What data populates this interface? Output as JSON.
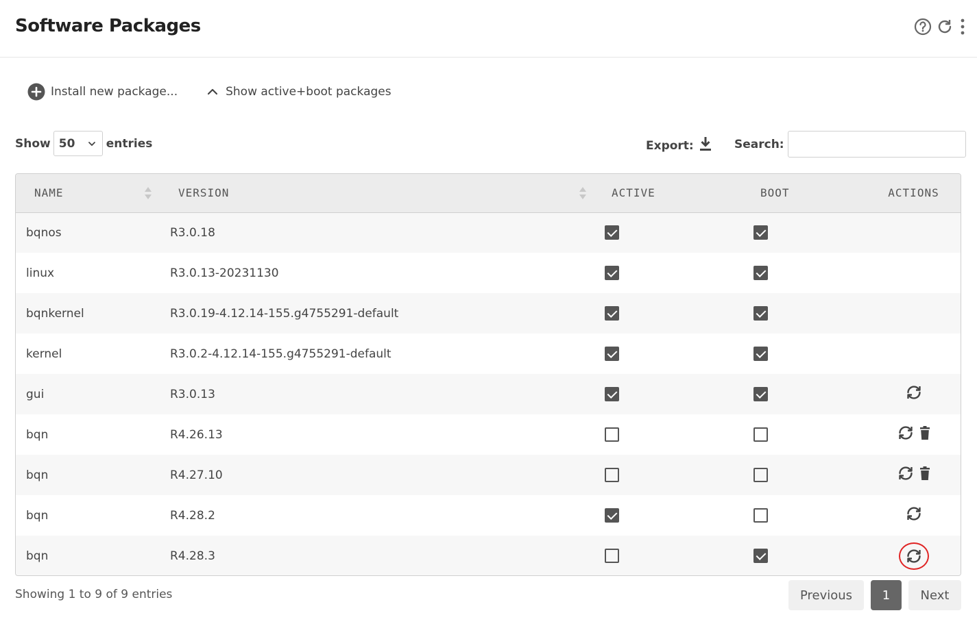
{
  "header": {
    "title": "Software Packages",
    "icons": [
      "help-icon",
      "refresh-icon",
      "more-vertical-icon"
    ]
  },
  "toolbar": {
    "install_label": "Install new package...",
    "show_packages_label": "Show active+boot packages"
  },
  "entries": {
    "show_label": "Show",
    "value": "50",
    "suffix": "entries"
  },
  "export": {
    "label": "Export:"
  },
  "search": {
    "label": "Search:",
    "value": ""
  },
  "table": {
    "columns": [
      "NAME",
      "VERSION",
      "ACTIVE",
      "BOOT",
      "ACTIONS"
    ],
    "rows": [
      {
        "name": "bqnos",
        "version": "R3.0.18",
        "active": true,
        "boot": true,
        "actions": []
      },
      {
        "name": "linux",
        "version": "R3.0.13-20231130",
        "active": true,
        "boot": true,
        "actions": []
      },
      {
        "name": "bqnkernel",
        "version": "R3.0.19-4.12.14-155.g4755291-default",
        "active": true,
        "boot": true,
        "actions": []
      },
      {
        "name": "kernel",
        "version": "R3.0.2-4.12.14-155.g4755291-default",
        "active": true,
        "boot": true,
        "actions": []
      },
      {
        "name": "gui",
        "version": "R3.0.13",
        "active": true,
        "boot": true,
        "actions": [
          "switch"
        ]
      },
      {
        "name": "bqn",
        "version": "R4.26.13",
        "active": false,
        "boot": false,
        "actions": [
          "switch",
          "delete"
        ]
      },
      {
        "name": "bqn",
        "version": "R4.27.10",
        "active": false,
        "boot": false,
        "actions": [
          "switch",
          "delete"
        ]
      },
      {
        "name": "bqn",
        "version": "R4.28.2",
        "active": true,
        "boot": false,
        "actions": [
          "switch"
        ]
      },
      {
        "name": "bqn",
        "version": "R4.28.3",
        "active": false,
        "boot": true,
        "actions": [
          "switch"
        ],
        "highlighted": true
      }
    ]
  },
  "footer": {
    "info": "Showing 1 to 9 of 9 entries",
    "prev_label": "Previous",
    "current_page": "1",
    "next_label": "Next"
  },
  "colors": {
    "highlight": "#e02424",
    "header_bg": "#ececec",
    "pager_active": "#666666"
  }
}
